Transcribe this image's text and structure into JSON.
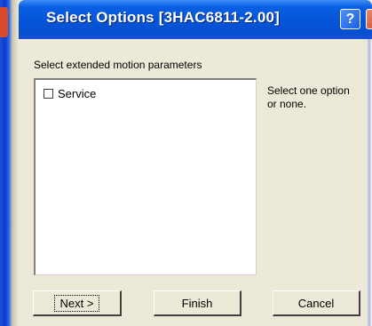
{
  "window": {
    "title": "Select Options [3HAC6811-2.00]",
    "help_glyph": "?",
    "close_glyph": "✕"
  },
  "dialog": {
    "instruction": "Select extended motion parameters",
    "hint": "Select one option or none."
  },
  "options": [
    {
      "label": "Service",
      "checked": false
    }
  ],
  "buttons": {
    "next": "Next >",
    "finish": "Finish",
    "cancel": "Cancel"
  },
  "colors": {
    "titlebar": "#0554d8",
    "dialog_bg": "#ece9d8",
    "close_button": "#c8432a"
  },
  "icons": {
    "help": "help-icon",
    "close": "close-icon"
  }
}
